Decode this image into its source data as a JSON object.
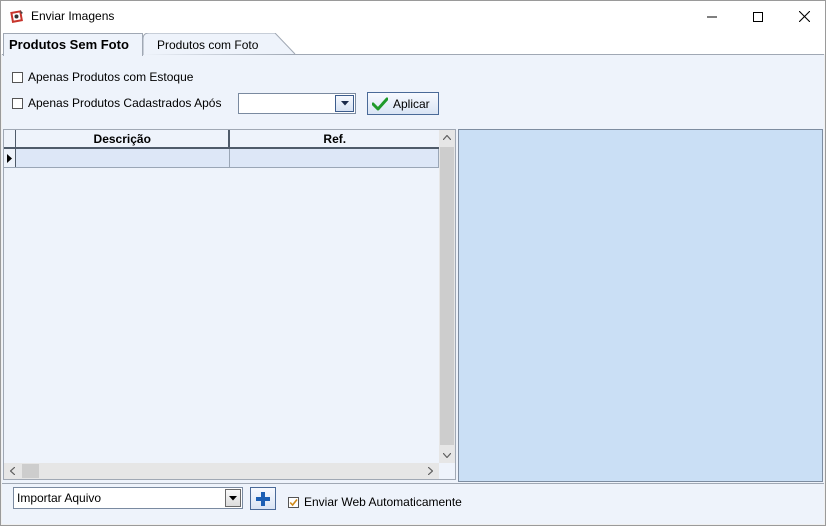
{
  "window": {
    "title": "Enviar Imagens",
    "icons": {
      "app": "app-icon",
      "minimize": "minimize-icon",
      "maximize": "maximize-icon",
      "close": "close-icon"
    }
  },
  "tabs": [
    {
      "label": "Produtos Sem Foto",
      "active": true
    },
    {
      "label": "Produtos com Foto",
      "active": false
    }
  ],
  "filters": {
    "stock_only": {
      "label": "Apenas Produtos com Estoque",
      "checked": false
    },
    "registered_after": {
      "label": "Apenas Produtos Cadastrados Após",
      "checked": false,
      "date_value": ""
    },
    "apply_label": "Aplicar"
  },
  "grid": {
    "columns": [
      "Descrição",
      "Ref."
    ],
    "rows": [
      {
        "descricao": "",
        "ref": ""
      }
    ]
  },
  "bottom": {
    "import_select_value": "Importar Aquivo",
    "auto_send": {
      "label": "Enviar Web Automaticamente",
      "checked": true
    }
  },
  "colors": {
    "panel_bg": "#eef3fb",
    "preview_bg": "#cadff5",
    "selected_row": "#dde7f7",
    "check_green": "#1e9a2a",
    "plus_blue": "#1c5fb4"
  }
}
